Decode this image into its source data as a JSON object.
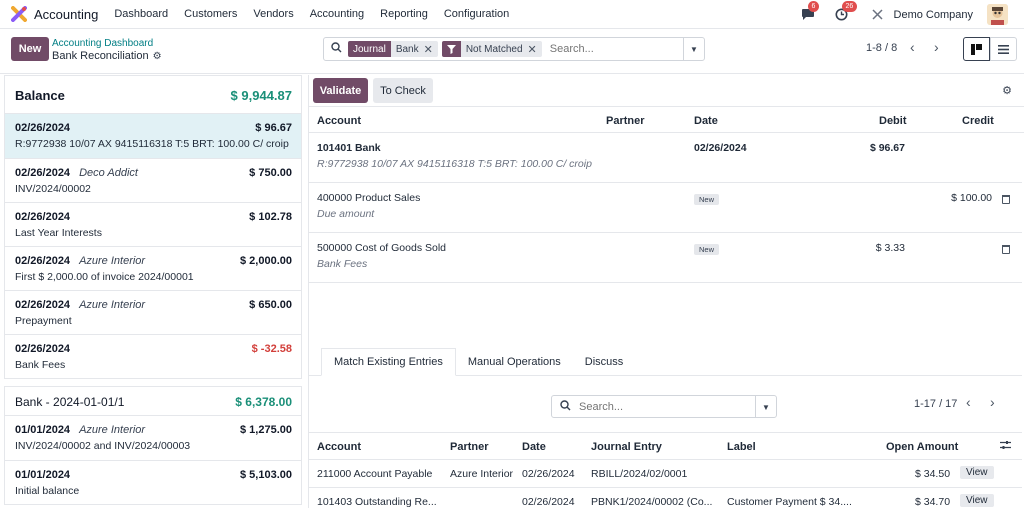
{
  "topnav": {
    "app_name": "Accounting",
    "menu": [
      "Dashboard",
      "Customers",
      "Vendors",
      "Accounting",
      "Reporting",
      "Configuration"
    ],
    "chat_badge": "6",
    "activity_badge": "26",
    "company": "Demo Company"
  },
  "control": {
    "new_label": "New",
    "breadcrumb_parent": "Accounting Dashboard",
    "breadcrumb_current": "Bank Reconciliation",
    "facets": [
      {
        "key": "Journal",
        "value": "Bank"
      },
      {
        "key": "filter-icon",
        "value": "Not Matched"
      }
    ],
    "search_placeholder": "Search...",
    "pager": "1-8 / 8"
  },
  "left": {
    "balance_label": "Balance",
    "balance_amount": "$ 9,944.87",
    "lines": [
      {
        "date": "02/26/2024",
        "partner": "",
        "amount": "$ 96.67",
        "label": "R:9772938 10/07 AX 9415116318 T:5 BRT: 100.00 C/ croip",
        "negative": false
      },
      {
        "date": "02/26/2024",
        "partner": "Deco Addict",
        "amount": "$ 750.00",
        "label": "INV/2024/00002",
        "negative": false
      },
      {
        "date": "02/26/2024",
        "partner": "",
        "amount": "$ 102.78",
        "label": "Last Year Interests",
        "negative": false
      },
      {
        "date": "02/26/2024",
        "partner": "Azure Interior",
        "amount": "$ 2,000.00",
        "label": "First $ 2,000.00 of invoice 2024/00001",
        "negative": false
      },
      {
        "date": "02/26/2024",
        "partner": "Azure Interior",
        "amount": "$ 650.00",
        "label": "Prepayment",
        "negative": false
      },
      {
        "date": "02/26/2024",
        "partner": "",
        "amount": "$ -32.58",
        "label": "Bank Fees",
        "negative": true
      }
    ],
    "statement2_label": "Bank - 2024-01-01/1",
    "statement2_amount": "$ 6,378.00",
    "lines2": [
      {
        "date": "01/01/2024",
        "partner": "Azure Interior",
        "amount": "$ 1,275.00",
        "label": "INV/2024/00002 and INV/2024/00003"
      },
      {
        "date": "01/01/2024",
        "partner": "",
        "amount": "$ 5,103.00",
        "label": "Initial balance"
      }
    ]
  },
  "right": {
    "validate_label": "Validate",
    "tocheck_label": "To Check",
    "headers": {
      "account": "Account",
      "partner": "Partner",
      "date": "Date",
      "debit": "Debit",
      "credit": "Credit"
    },
    "lines": [
      {
        "account": "101401 Bank",
        "label": "R:9772938 10/07 AX 9415116318 T:5 BRT: 100.00 C/ croip",
        "date": "02/26/2024",
        "debit": "$ 96.67",
        "credit": ""
      },
      {
        "account": "400000 Product Sales",
        "label": "Due amount",
        "tag": "New",
        "debit": "",
        "credit": "$ 100.00"
      },
      {
        "account": "500000 Cost of Goods Sold",
        "label": "Bank Fees",
        "tag": "New",
        "debit": "$ 3.33",
        "credit": ""
      }
    ],
    "tabs": [
      "Match Existing Entries",
      "Manual Operations",
      "Discuss"
    ],
    "match_search_placeholder": "Search...",
    "match_pager": "1-17 / 17",
    "match_headers": {
      "account": "Account",
      "partner": "Partner",
      "date": "Date",
      "journal_entry": "Journal Entry",
      "label": "Label",
      "open_amount": "Open Amount"
    },
    "match_rows": [
      {
        "account": "211000 Account Payable",
        "partner": "Azure Interior",
        "date": "02/26/2024",
        "journal_entry": "RBILL/2024/02/0001",
        "label": "",
        "open_amount": "$ 34.50",
        "action": "View"
      },
      {
        "account": "101403 Outstanding Re...",
        "partner": "",
        "date": "02/26/2024",
        "journal_entry": "PBNK1/2024/00002 (Co...",
        "label": "Customer Payment $ 34....",
        "open_amount": "$ 34.70",
        "action": "View"
      }
    ]
  },
  "colors": {
    "brand": "#714b67",
    "positive": "#1a8f78",
    "negative": "#d23f3a",
    "selected": "#e1f1f5"
  }
}
